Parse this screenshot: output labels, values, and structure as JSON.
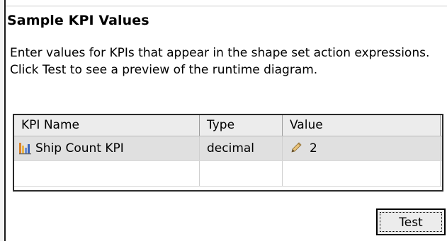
{
  "section": {
    "title": "Sample KPI Values",
    "description": "Enter values for KPIs that appear in the shape set action expressions. Click Test to see a preview of the runtime diagram."
  },
  "table": {
    "headers": [
      "KPI Name",
      "Type",
      "Value"
    ],
    "rows": [
      {
        "name": "Ship Count KPI",
        "type": "decimal",
        "value": "2",
        "icon": "kpi-bar-chart-icon",
        "value_icon": "pencil-edit-icon"
      },
      {
        "name": "",
        "type": "",
        "value": ""
      }
    ]
  },
  "actions": {
    "test_label": "Test"
  },
  "colors": {
    "selected_row": "#e0e0e0",
    "header_bg": "#ececec",
    "button_bg": "#ececec"
  }
}
